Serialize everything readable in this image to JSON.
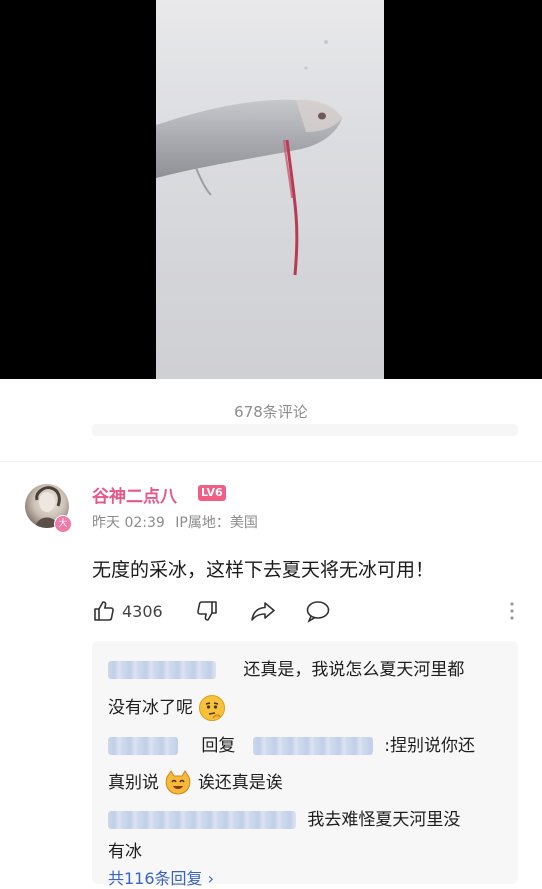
{
  "comments_header": {
    "count_label": "678条评论"
  },
  "comment": {
    "username": "谷神二点八",
    "level": "LV6",
    "avatar_badge": "大",
    "time": "昨天 02:39",
    "ip_label": "IP属地：美国",
    "text": "无度的采冰，这样下去夏天将无冰可用！",
    "like_count": "4306"
  },
  "replies": [
    {
      "text": "还真是，我说怎么夏天河里都",
      "continuation": "没有冰了呢"
    },
    {
      "reply_word": "回复",
      "text": ":捏别说你还",
      "continuation_a": "真别说",
      "continuation_b": "诶还真是诶"
    },
    {
      "text": "我去难怪夏天河里没",
      "continuation": "有冰"
    }
  ],
  "replies_total": "共116条回复 ›",
  "icons": [
    "thumbs-up-icon",
    "thumbs-down-icon",
    "share-icon",
    "chat-bubble-icon",
    "more-vertical-icon",
    "thinking-emoji-icon",
    "cat-emoji-icon"
  ],
  "colors": {
    "username": "#e8578a",
    "level_badge": "#f25d84",
    "link": "#3a63c4"
  }
}
